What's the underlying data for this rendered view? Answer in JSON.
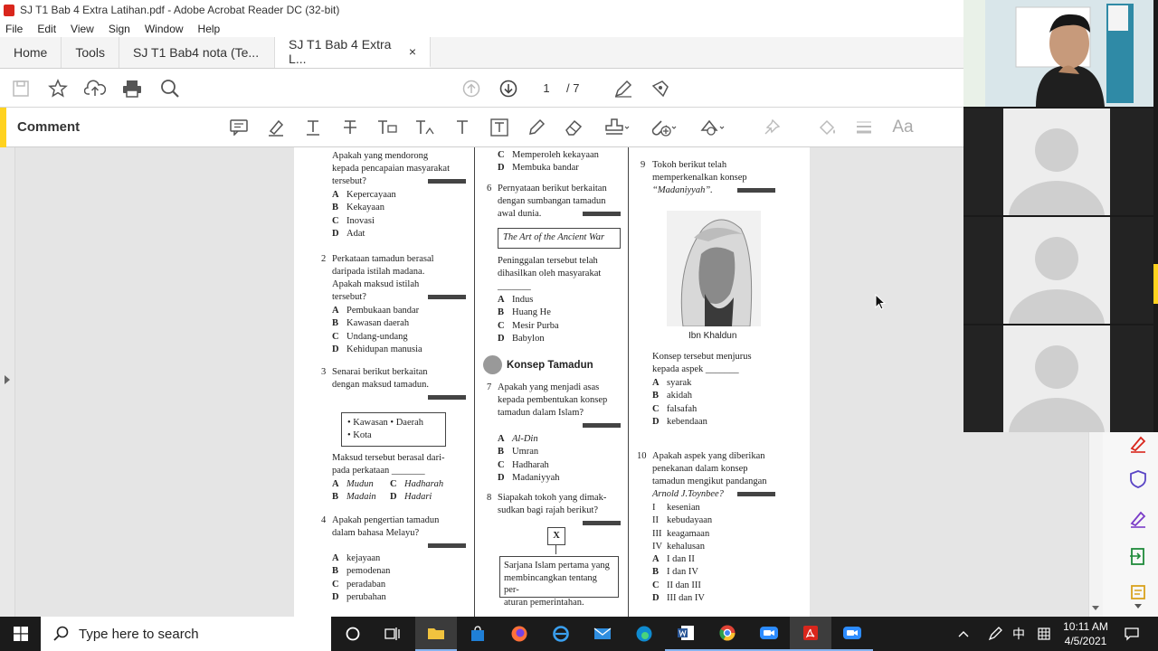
{
  "window": {
    "title": "SJ T1 Bab 4 Extra Latihan.pdf - Adobe Acrobat Reader DC (32-bit)"
  },
  "menu": [
    "File",
    "Edit",
    "View",
    "Sign",
    "Window",
    "Help"
  ],
  "tabs": {
    "home": "Home",
    "tools": "Tools",
    "doc1": "SJ T1 Bab4 nota (Te...",
    "doc2": "SJ T1 Bab 4 Extra L...",
    "close": "×"
  },
  "toolbar": {
    "page_current": "1",
    "page_total": "/ 7"
  },
  "comment": {
    "label": "Comment",
    "font_button": "Aa"
  },
  "page": {
    "c1": {
      "q1_lines": [
        "Apakah yang mendorong",
        "kepada pencapaian masyarakat",
        "tersebut?"
      ],
      "q1_opts": [
        [
          "A",
          "Kepercayaan"
        ],
        [
          "B",
          "Kekayaan"
        ],
        [
          "C",
          "Inovasi"
        ],
        [
          "D",
          "Adat"
        ]
      ],
      "q2_num": "2",
      "q2_lines": [
        "Perkataan tamadun berasal",
        "daripada istilah madana.",
        "Apakah maksud istilah",
        "tersebut?"
      ],
      "q2_opts": [
        [
          "A",
          "Pembukaan bandar"
        ],
        [
          "B",
          "Kawasan daerah"
        ],
        [
          "C",
          "Undang-undang"
        ],
        [
          "D",
          "Kehidupan manusia"
        ]
      ],
      "q3_num": "3",
      "q3_lines": [
        "Senarai berikut berkaitan",
        "dengan maksud tamadun."
      ],
      "q3_box": [
        "• Kawasan  • Daerah",
        "• Kota"
      ],
      "q3_after": [
        "Maksud tersebut berasal dari-",
        "pada perkataan _______"
      ],
      "q3_opts": [
        [
          "A",
          "Mudun"
        ],
        [
          "C",
          "Hadharah"
        ],
        [
          "B",
          "Madain"
        ],
        [
          "D",
          "Hadari"
        ]
      ],
      "q4_num": "4",
      "q4_lines": [
        "Apakah pengertian tamadun",
        "dalam bahasa Melayu?"
      ],
      "q4_opts": [
        [
          "A",
          "kejayaan"
        ],
        [
          "B",
          "pemodenan"
        ],
        [
          "C",
          "peradaban"
        ],
        [
          "D",
          "perubahan"
        ]
      ]
    },
    "c2": {
      "q5_tail": [
        [
          "C",
          "Memperoleh kekayaan"
        ],
        [
          "D",
          "Membuka bandar"
        ]
      ],
      "q6_num": "6",
      "q6_lines": [
        "Pernyataan berikut berkaitan",
        "dengan sumbangan tamadun",
        "awal dunia."
      ],
      "q6_box": "The Art of the Ancient War",
      "q6_after": [
        "Peninggalan tersebut telah",
        "dihasilkan oleh masyarakat",
        "_______"
      ],
      "q6_opts": [
        [
          "A",
          "Indus"
        ],
        [
          "B",
          "Huang He"
        ],
        [
          "C",
          "Mesir Purba"
        ],
        [
          "D",
          "Babylon"
        ]
      ],
      "section": "Konsep Tamadun",
      "q7_num": "7",
      "q7_lines": [
        "Apakah yang menjadi asas",
        "kepada pembentukan konsep",
        "tamadun dalam Islam?"
      ],
      "q7_opts": [
        [
          "A",
          "Al-Din"
        ],
        [
          "B",
          "Umran"
        ],
        [
          "C",
          "Hadharah"
        ],
        [
          "D",
          "Madaniyyah"
        ]
      ],
      "q8_num": "8",
      "q8_lines": [
        "Siapakah tokoh yang dimak-",
        "sudkan bagi rajah berikut?"
      ],
      "q8_x": "X",
      "q8_box": [
        "Sarjana Islam pertama yang",
        "membincangkan tentang per-",
        "aturan pemerintahan."
      ]
    },
    "c3": {
      "q9_num": "9",
      "q9_lines": [
        "Tokoh berikut telah",
        "memperkenalkan konsep",
        "“Madaniyyah”."
      ],
      "portrait_caption": "Ibn Khaldun",
      "q9_after": [
        "Konsep tersebut menjurus",
        "kepada aspek _______"
      ],
      "q9_opts": [
        [
          "A",
          "syarak"
        ],
        [
          "B",
          "akidah"
        ],
        [
          "C",
          "falsafah"
        ],
        [
          "D",
          "kebendaan"
        ]
      ],
      "q10_num": "10",
      "q10_lines": [
        "Apakah aspek yang diberikan",
        "penekanan dalam konsep",
        "tamadun mengikut pandangan",
        "Arnold J.Toynbee?"
      ],
      "q10_items": [
        [
          "I",
          "kesenian"
        ],
        [
          "II",
          "kebudayaan"
        ],
        [
          "III",
          "keagamaan"
        ],
        [
          "IV",
          "kehalusan"
        ]
      ],
      "q10_opts": [
        [
          "A",
          "I dan II"
        ],
        [
          "B",
          "I dan IV"
        ],
        [
          "C",
          "II dan III"
        ],
        [
          "D",
          "III dan IV"
        ]
      ]
    }
  },
  "taskbar": {
    "search_placeholder": "Type here to search",
    "time": "10:11 AM",
    "date": "4/5/2021",
    "lang": "中"
  },
  "colors": {
    "accent_yellow": "#ffd21f",
    "acrobat_red": "#d9261c",
    "taskbar": "#1b1b1b"
  }
}
